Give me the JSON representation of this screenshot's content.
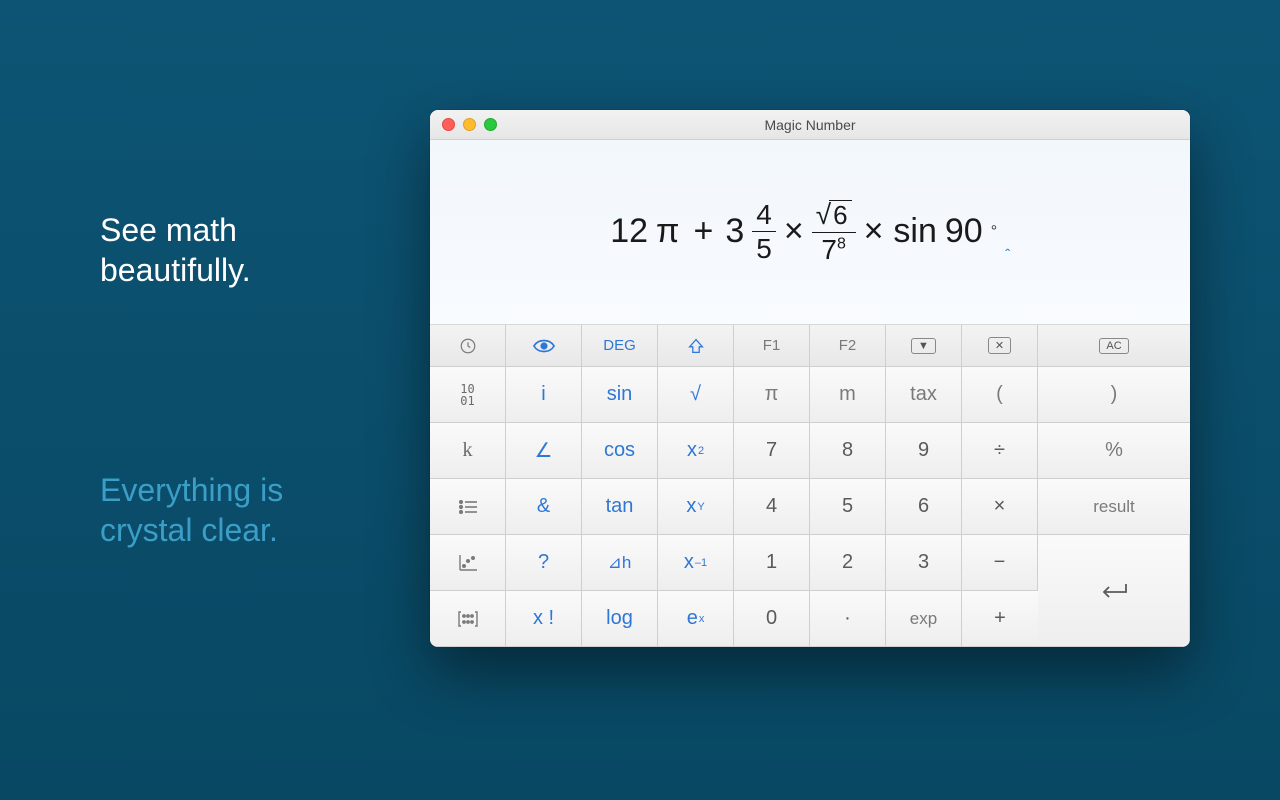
{
  "taglines": {
    "white": "See math\nbeautifully.",
    "blue": "Everything is\ncrystal clear."
  },
  "window": {
    "title": "Magic Number"
  },
  "expression": {
    "a": "12",
    "pi": "π",
    "plus": "+",
    "b_whole": "3",
    "b_num": "4",
    "b_den": "5",
    "times": "×",
    "c_rad": "6",
    "c_base": "7",
    "c_exp": "8",
    "sin": "sin",
    "angle": "90",
    "deg": "°"
  },
  "toolbar": {
    "deg": "DEG",
    "f1": "F1",
    "f2": "F2",
    "ac": "AC"
  },
  "keys": {
    "i": "i",
    "sin": "sin",
    "sqrt": "√",
    "pi": "π",
    "m": "m",
    "tax": "tax",
    "lparen": "(",
    "rparen": ")",
    "k": "k",
    "angle": "∠",
    "cos": "cos",
    "xsq_base": "x",
    "xsq_exp": "2",
    "seven": "7",
    "eight": "8",
    "nine": "9",
    "divide": "÷",
    "percent": "%",
    "amp": "&",
    "tan": "tan",
    "xy_base": "x",
    "xy_exp": "Y",
    "four": "4",
    "five": "5",
    "six": "6",
    "multiply": "×",
    "result": "result",
    "question": "?",
    "dh": "⊿h",
    "xinv_base": "x",
    "xinv_exp": "–1",
    "one": "1",
    "two": "2",
    "three": "3",
    "minus": "−",
    "xfact": "x !",
    "log": "log",
    "ex_base": "e",
    "ex_exp": "x",
    "zero": "0",
    "dot": "·",
    "exp": "exp",
    "plus": "+"
  }
}
